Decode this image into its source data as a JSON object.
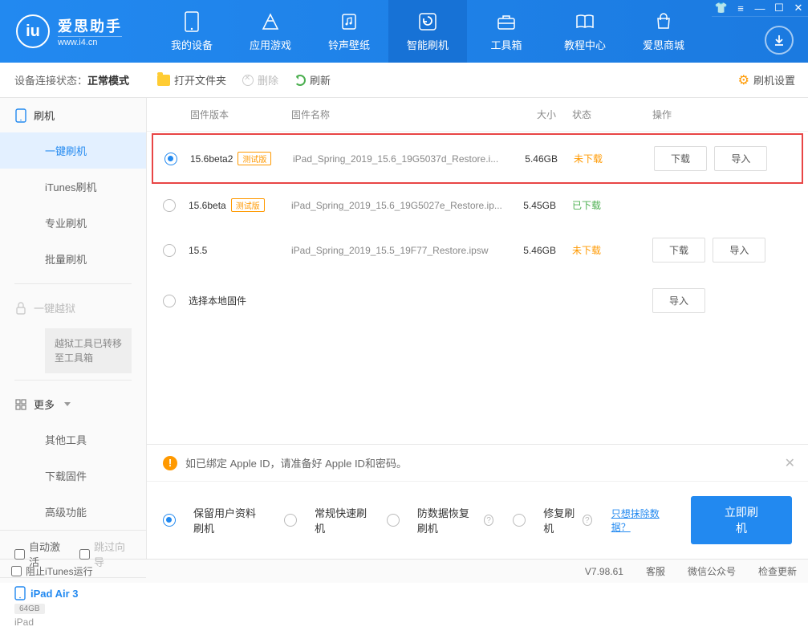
{
  "logo": {
    "title": "爱思助手",
    "url": "www.i4.cn"
  },
  "nav": [
    {
      "label": "我的设备"
    },
    {
      "label": "应用游戏"
    },
    {
      "label": "铃声壁纸"
    },
    {
      "label": "智能刷机"
    },
    {
      "label": "工具箱"
    },
    {
      "label": "教程中心"
    },
    {
      "label": "爱思商城"
    }
  ],
  "status": {
    "prefix": "设备连接状态：",
    "value": "正常模式"
  },
  "toolbar": {
    "open": "打开文件夹",
    "delete": "删除",
    "refresh": "刷新",
    "settings": "刷机设置"
  },
  "sidebar": {
    "flash": "刷机",
    "items": [
      "一键刷机",
      "iTunes刷机",
      "专业刷机",
      "批量刷机"
    ],
    "jailbreak": "一键越狱",
    "jailbreak_note": "越狱工具已转移至工具箱",
    "more": "更多",
    "more_items": [
      "其他工具",
      "下载固件",
      "高级功能"
    ],
    "auto_activate": "自动激活",
    "skip_guide": "跳过向导",
    "device_name": "iPad Air 3",
    "device_storage": "64GB",
    "device_type": "iPad"
  },
  "table": {
    "headers": {
      "version": "固件版本",
      "name": "固件名称",
      "size": "大小",
      "status": "状态",
      "action": "操作"
    },
    "rows": [
      {
        "version": "15.6beta2",
        "beta": "测试版",
        "name": "iPad_Spring_2019_15.6_19G5037d_Restore.i...",
        "size": "5.46GB",
        "status": "未下载",
        "status_cls": "not",
        "selected": true,
        "actions": true
      },
      {
        "version": "15.6beta",
        "beta": "测试版",
        "name": "iPad_Spring_2019_15.6_19G5027e_Restore.ip...",
        "size": "5.45GB",
        "status": "已下载",
        "status_cls": "done",
        "selected": false,
        "actions": false
      },
      {
        "version": "15.5",
        "beta": "",
        "name": "iPad_Spring_2019_15.5_19F77_Restore.ipsw",
        "size": "5.46GB",
        "status": "未下载",
        "status_cls": "not",
        "selected": false,
        "actions": true
      }
    ],
    "local_label": "选择本地固件",
    "download_btn": "下载",
    "import_btn": "导入"
  },
  "warning": "如已绑定 Apple ID，请准备好 Apple ID和密码。",
  "flash_opts": [
    "保留用户资料刷机",
    "常规快速刷机",
    "防数据恢复刷机",
    "修复刷机"
  ],
  "erase_link": "只想抹除数据？",
  "flash_now": "立即刷机",
  "footer": {
    "block_itunes": "阻止iTunes运行",
    "version": "V7.98.61",
    "links": [
      "客服",
      "微信公众号",
      "检查更新"
    ]
  }
}
